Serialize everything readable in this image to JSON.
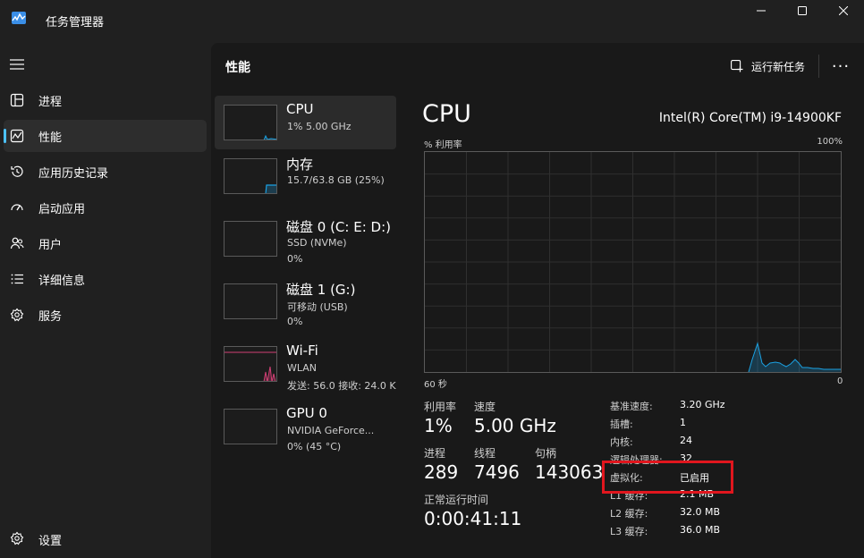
{
  "window": {
    "title": "任务管理器",
    "controls": {
      "minimize": "—",
      "maximize": "☐",
      "close": "✕"
    }
  },
  "sidebar": {
    "items": [
      {
        "label": "进程",
        "icon": "processes-icon"
      },
      {
        "label": "性能",
        "icon": "performance-icon",
        "active": true
      },
      {
        "label": "应用历史记录",
        "icon": "app-history-icon"
      },
      {
        "label": "启动应用",
        "icon": "startup-apps-icon"
      },
      {
        "label": "用户",
        "icon": "users-icon"
      },
      {
        "label": "详细信息",
        "icon": "details-icon"
      },
      {
        "label": "服务",
        "icon": "services-icon"
      }
    ],
    "settings_label": "设置"
  },
  "header": {
    "title": "性能",
    "run_task_label": "运行新任务",
    "more_label": "···"
  },
  "perf_list": [
    {
      "name": "CPU",
      "sub1": "1% 5.00 GHz",
      "sub2": ""
    },
    {
      "name": "内存",
      "sub1": "15.7/63.8 GB (25%)",
      "sub2": ""
    },
    {
      "name": "磁盘 0 (C: E: D:)",
      "sub1": "SSD (NVMe)",
      "sub2": "0%"
    },
    {
      "name": "磁盘 1 (G:)",
      "sub1": "可移动 (USB)",
      "sub2": "0%"
    },
    {
      "name": "Wi-Fi",
      "sub1": "WLAN",
      "sub2": "发送: 56.0 接收: 24.0 K"
    },
    {
      "name": "GPU 0",
      "sub1": "NVIDIA GeForce...",
      "sub2": "0% (45 °C)"
    }
  ],
  "detail": {
    "title": "CPU",
    "model": "Intel(R) Core(TM) i9-14900KF",
    "graph": {
      "y_label": "% 利用率",
      "y_max_label": "100%",
      "x_left_label": "60 秒",
      "x_right_label": "0"
    },
    "stats": {
      "utilization_label": "利用率",
      "utilization_value": "1%",
      "speed_label": "速度",
      "speed_value": "5.00 GHz",
      "processes_label": "进程",
      "processes_value": "289",
      "threads_label": "线程",
      "threads_value": "7496",
      "handles_label": "句柄",
      "handles_value": "143063",
      "uptime_label": "正常运行时间",
      "uptime_value": "0:00:41:11"
    },
    "specs": [
      {
        "label": "基准速度:",
        "value": "3.20 GHz"
      },
      {
        "label": "插槽:",
        "value": "1"
      },
      {
        "label": "内核:",
        "value": "24"
      },
      {
        "label": "逻辑处理器:",
        "value": "32"
      },
      {
        "label": "虚拟化:",
        "value": "已启用"
      },
      {
        "label": "L1 缓存:",
        "value": "2.1 MB"
      },
      {
        "label": "L2 缓存:",
        "value": "32.0 MB"
      },
      {
        "label": "L3 缓存:",
        "value": "36.0 MB"
      }
    ]
  },
  "colors": {
    "accent": "#4cc2ff",
    "cpu_line": "#1ba1e2",
    "wifi_line": "#d13f74",
    "highlight": "#e0161e"
  }
}
